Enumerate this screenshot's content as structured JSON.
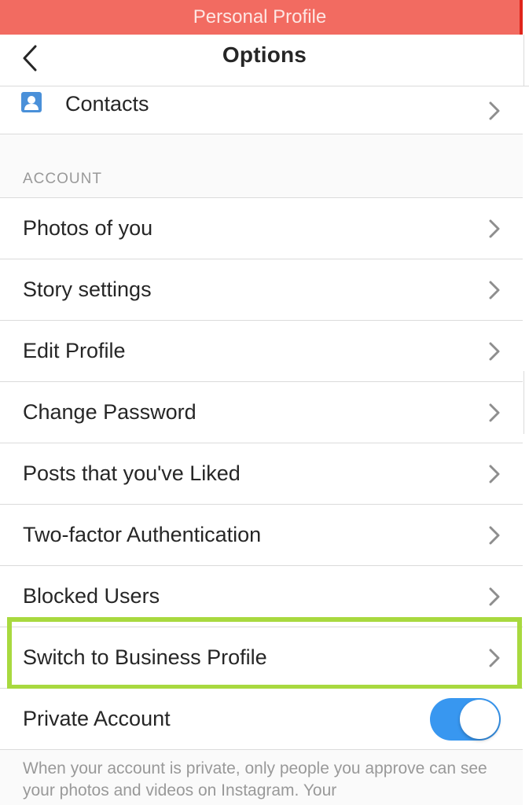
{
  "banner": {
    "title": "Personal Profile",
    "color": "#f26b61"
  },
  "navbar": {
    "back_icon": "chevron-left-icon",
    "title": "Options"
  },
  "contacts": {
    "icon": "contact-card-icon",
    "label": "Contacts"
  },
  "account_section": {
    "header": "ACCOUNT",
    "items": [
      {
        "label": "Photos of you"
      },
      {
        "label": "Story settings"
      },
      {
        "label": "Edit Profile"
      },
      {
        "label": "Change Password"
      },
      {
        "label": "Posts that you've Liked"
      },
      {
        "label": "Two-factor Authentication"
      },
      {
        "label": "Blocked Users"
      },
      {
        "label": "Switch to Business Profile",
        "highlighted": true
      }
    ]
  },
  "private_account": {
    "label": "Private Account",
    "enabled": true,
    "toggle_color": "#3897f0"
  },
  "footer_note": "When your account is private, only people you approve can see your photos and videos on Instagram. Your",
  "highlight_color": "#a8d93f"
}
